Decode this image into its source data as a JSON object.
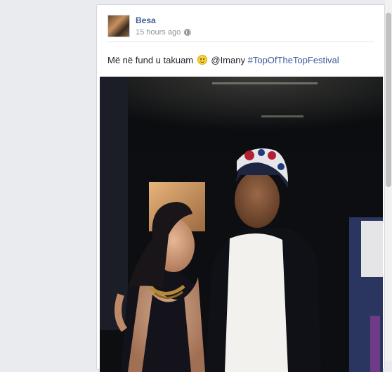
{
  "post": {
    "author": "Besa",
    "timestamp": "15 hours ago",
    "privacy_icon": "globe-icon",
    "text_before": "Më në fund u takuam ",
    "emoji": "smiley-emoji",
    "mention": "@Imany",
    "hashtag": "#TopOfTheTopFestival"
  },
  "colors": {
    "link_blue": "#3b5998",
    "page_bg": "#e9ebee",
    "text": "#1d2129",
    "meta_gray": "#90949c"
  }
}
